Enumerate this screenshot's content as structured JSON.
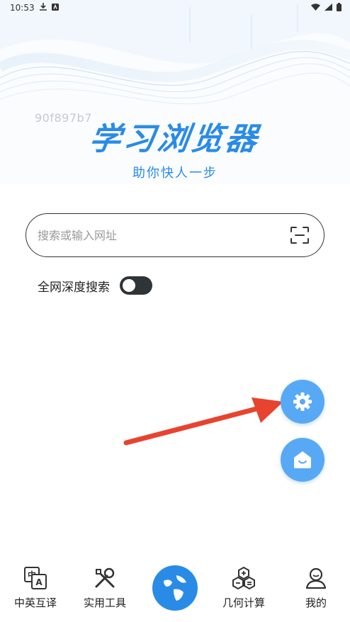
{
  "status_bar": {
    "time": "10:53"
  },
  "watermark": "90f897b7",
  "hero": {
    "title": "学习浏览器",
    "slogan": "助你快人一步"
  },
  "search": {
    "placeholder": "搜索或输入网址",
    "value": ""
  },
  "deep_search": {
    "label": "全网深度搜索",
    "enabled": false
  },
  "nav": {
    "translate": "中英互译",
    "tools": "实用工具",
    "geometry": "几何计算",
    "mine": "我的"
  },
  "colors": {
    "accent": "#2a8be6",
    "fab": "#58a9f5",
    "arrow": "#e8432f",
    "toggle": "#2f3438"
  },
  "icons": {
    "scan": "scan-icon",
    "settings": "gear-icon",
    "home": "home-icon",
    "translate": "translate-icon",
    "tools": "tools-icon",
    "browser": "globe-icon",
    "geometry": "geometry-icon",
    "mine": "user-icon"
  }
}
